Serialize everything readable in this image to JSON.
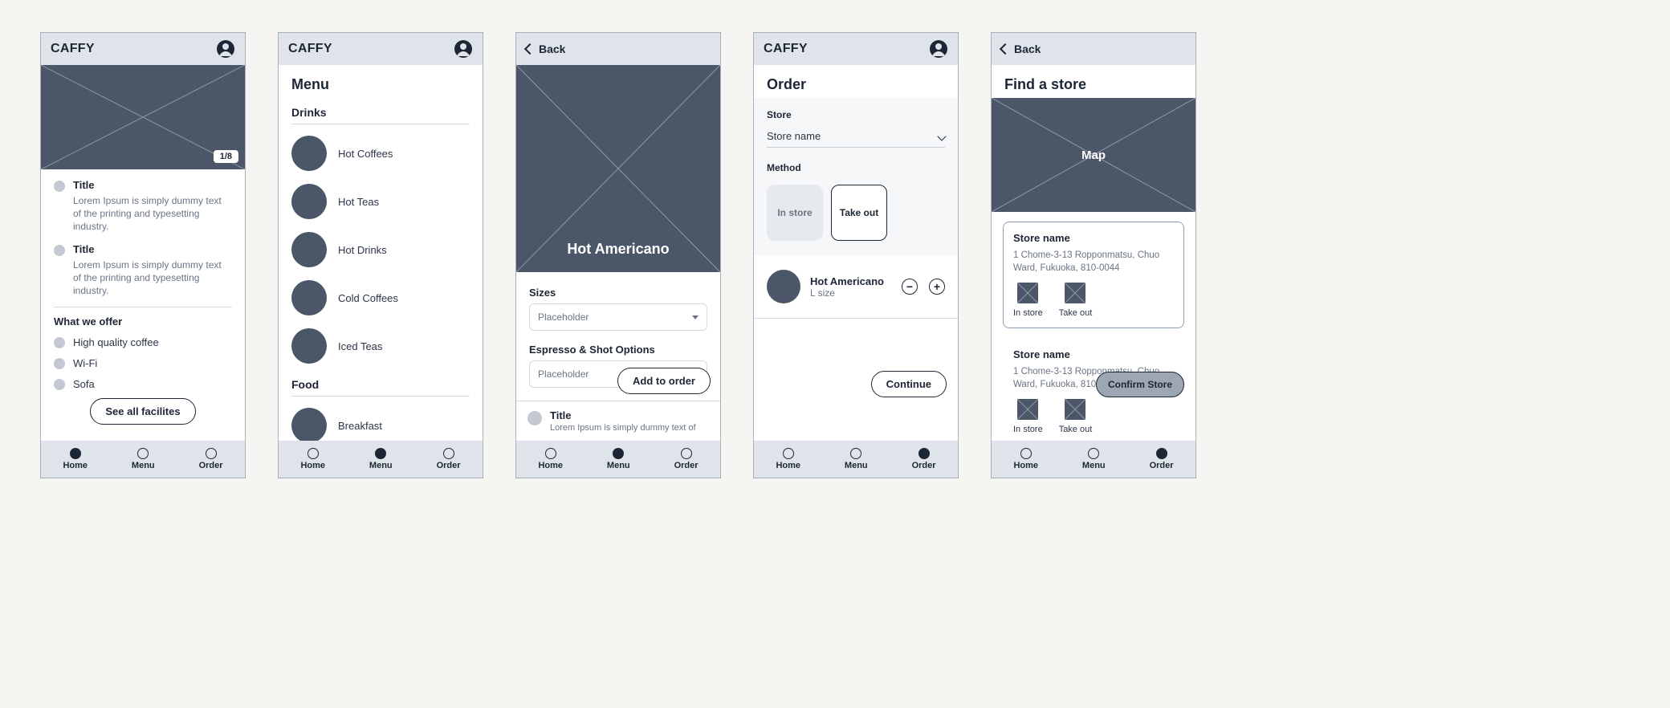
{
  "app": {
    "brand": "CAFFY",
    "back_label": "Back"
  },
  "tabs": {
    "home": "Home",
    "menu": "Menu",
    "order": "Order",
    "active": [
      "home",
      "menu",
      "menu",
      "order",
      "order"
    ]
  },
  "home": {
    "hero_badge": "1/8",
    "news": [
      {
        "title": "Title",
        "desc": "Lorem Ipsum is simply dummy text of the printing and typesetting industry."
      },
      {
        "title": "Title",
        "desc": "Lorem Ipsum is simply dummy text of the printing and typesetting industry."
      }
    ],
    "offer_heading": "What we offer",
    "offers": [
      "High quality coffee",
      "Wi-Fi",
      "Sofa"
    ],
    "see_all": "See all facilites"
  },
  "menu": {
    "title": "Menu",
    "cat_drinks": "Drinks",
    "drinks": [
      "Hot Coffees",
      "Hot Teas",
      "Hot Drinks",
      "Cold Coffees",
      "Iced Teas"
    ],
    "cat_food": "Food",
    "food": [
      "Breakfast"
    ]
  },
  "product": {
    "name": "Hot Americano",
    "sizes_label": "Sizes",
    "sizes_placeholder": "Placeholder",
    "shot_label": "Espresso & Shot Options",
    "shot_placeholder": "Placeholder",
    "sheet_title": "Title",
    "sheet_desc": "Lorem Ipsum is simply dummy text of",
    "add_label": "Add to order"
  },
  "order": {
    "title": "Order",
    "store_label": "Store",
    "store_value": "Store name",
    "method_label": "Method",
    "method_in_store": "In store",
    "method_take_out": "Take out",
    "item_name": "Hot Americano",
    "item_sub": "L size",
    "continue": "Continue"
  },
  "stores": {
    "title": "Find a store",
    "map_label": "Map",
    "list": [
      {
        "name": "Store name",
        "addr": "1 Chome-3-13 Ropponmatsu, Chuo Ward, Fukuoka, 810-0044"
      },
      {
        "name": "Store name",
        "addr": "1 Chome-3-13 Ropponmatsu, Chuo Ward, Fukuoka, 810-0044"
      }
    ],
    "opt_in_store": "In store",
    "opt_take_out": "Take out",
    "confirm": "Confirm Store"
  }
}
